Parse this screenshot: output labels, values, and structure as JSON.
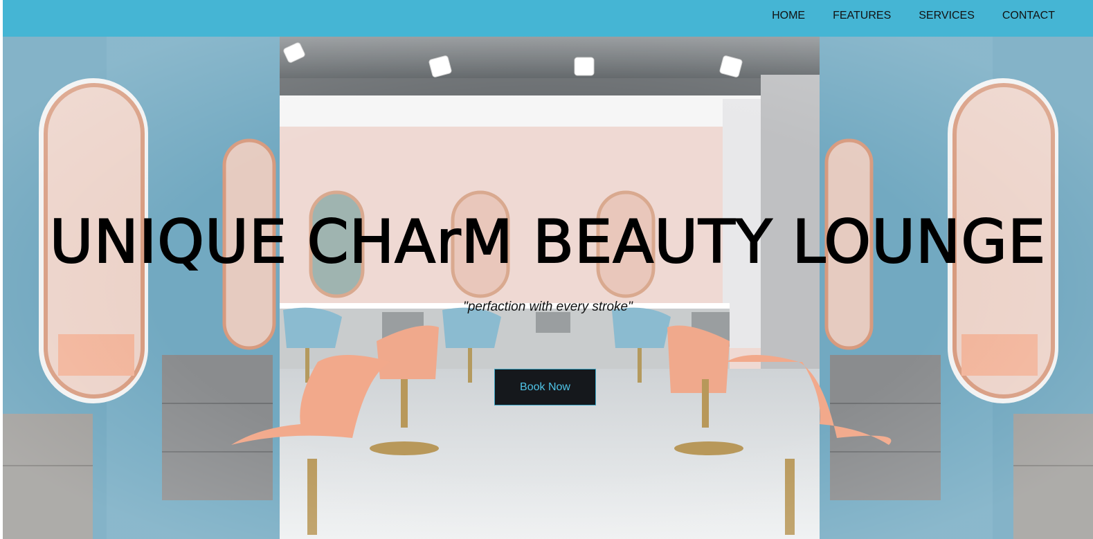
{
  "nav": {
    "items": [
      {
        "label": "HOME"
      },
      {
        "label": "FEATURES"
      },
      {
        "label": "SERVICES"
      },
      {
        "label": "CONTACT"
      }
    ]
  },
  "hero": {
    "title": "UNIQUE CHArM BEAUTY LOUNGE",
    "tagline": "\"perfaction with every stroke\"",
    "cta_label": "Book Now",
    "background_description_icon": "salon-interior-image"
  },
  "colors": {
    "navbar": "#45b5d4",
    "button_bg": "#15181c",
    "button_text": "#4fc3e6",
    "wall_blue": "#6fa9c2",
    "chair_peach": "#f0a98c",
    "back_wall_pink": "#efd6cf"
  }
}
